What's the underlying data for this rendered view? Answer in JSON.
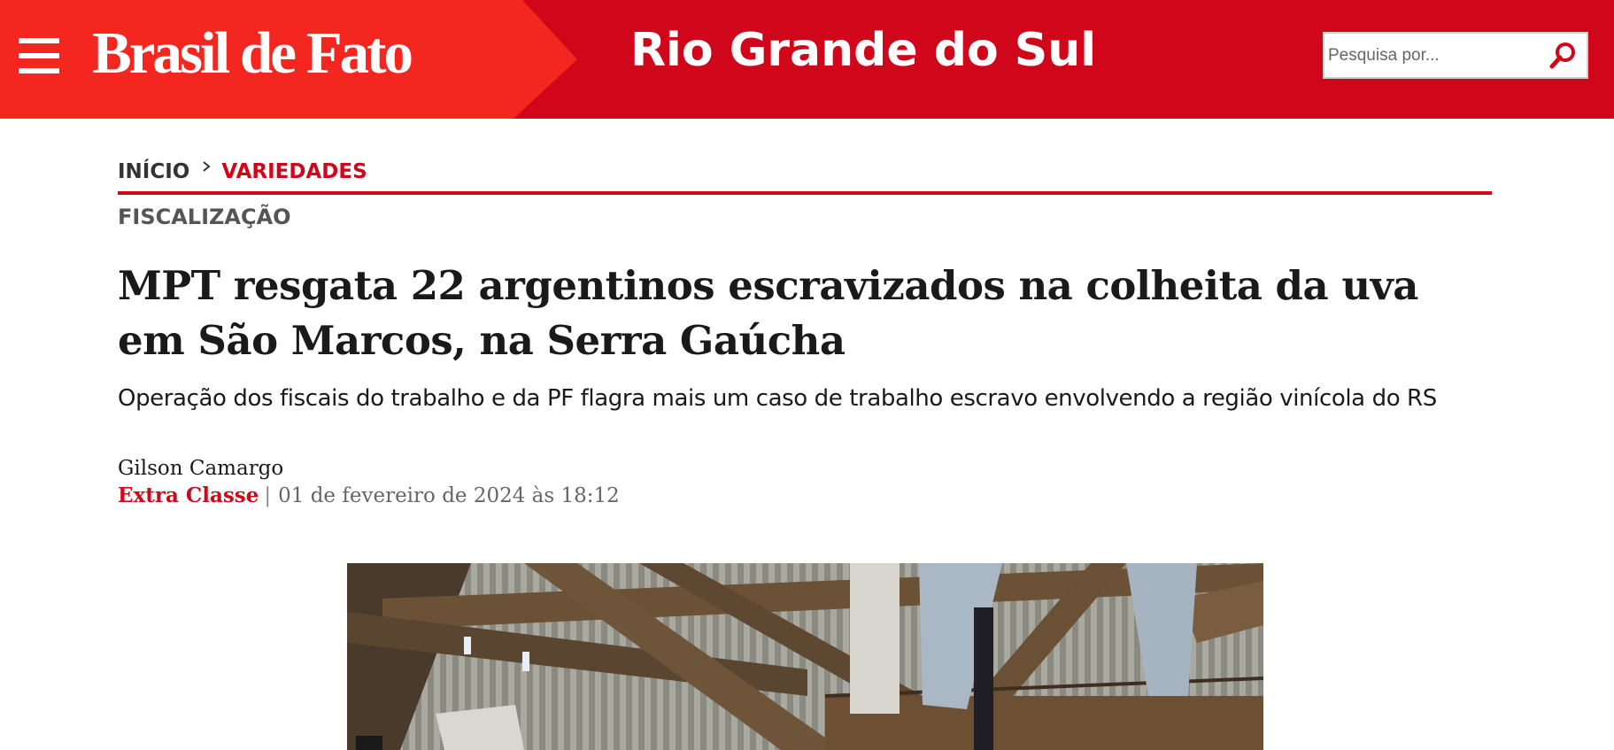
{
  "header": {
    "logo_text": "Brasil de Fato",
    "section_title": "Rio Grande do Sul",
    "search": {
      "placeholder": "Pesquisa por..."
    },
    "colors": {
      "primary": "#d0071a",
      "accent": "#f3271f"
    },
    "icons": {
      "menu": "hamburger-menu-icon",
      "search": "search-icon"
    }
  },
  "breadcrumb": {
    "home": "INÍCIO",
    "current": "VARIEDADES",
    "separator_icon": "chevron-right-icon"
  },
  "article": {
    "kicker": "FISCALIZAÇÃO",
    "headline": "MPT resgata 22 argentinos escravizados na colheita da uva em São Marcos, na Serra Gaúcha",
    "subtitle": "Operação dos fiscais do trabalho e da PF flagra mais um caso de trabalho escravo envolvendo a região vinícola do RS",
    "author": "Gilson Camargo",
    "source": "Extra Classe",
    "date": "01 de fevereiro de 2024 às 18:12"
  }
}
